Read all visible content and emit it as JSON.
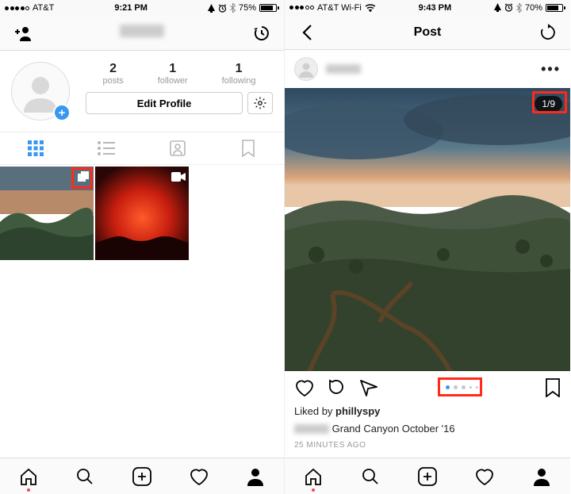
{
  "left": {
    "status": {
      "carrier": "AT&T",
      "time": "9:21 PM",
      "battery": "75%"
    },
    "nav": {
      "title_blurred": true
    },
    "profile": {
      "stats": [
        {
          "n": "2",
          "l": "posts"
        },
        {
          "n": "1",
          "l": "follower"
        },
        {
          "n": "1",
          "l": "following"
        }
      ],
      "edit_label": "Edit Profile"
    },
    "view_tabs": [
      "grid",
      "list",
      "tagged",
      "saved"
    ],
    "grid_items": [
      {
        "kind": "landscape",
        "badge": "carousel"
      },
      {
        "kind": "concert",
        "badge": "video"
      }
    ]
  },
  "right": {
    "status": {
      "carrier": "AT&T Wi-Fi",
      "time": "9:43 PM",
      "battery": "70%"
    },
    "nav": {
      "title": "Post"
    },
    "post": {
      "username_blurred": true,
      "counter": "1/9",
      "carousel_dots": 5,
      "liked_by_prefix": "Liked by ",
      "liked_by_user": "phillyspy",
      "caption": "Grand Canyon October '16",
      "time": "25 MINUTES AGO"
    }
  },
  "tabbar": [
    "home",
    "search",
    "add",
    "activity",
    "profile"
  ]
}
